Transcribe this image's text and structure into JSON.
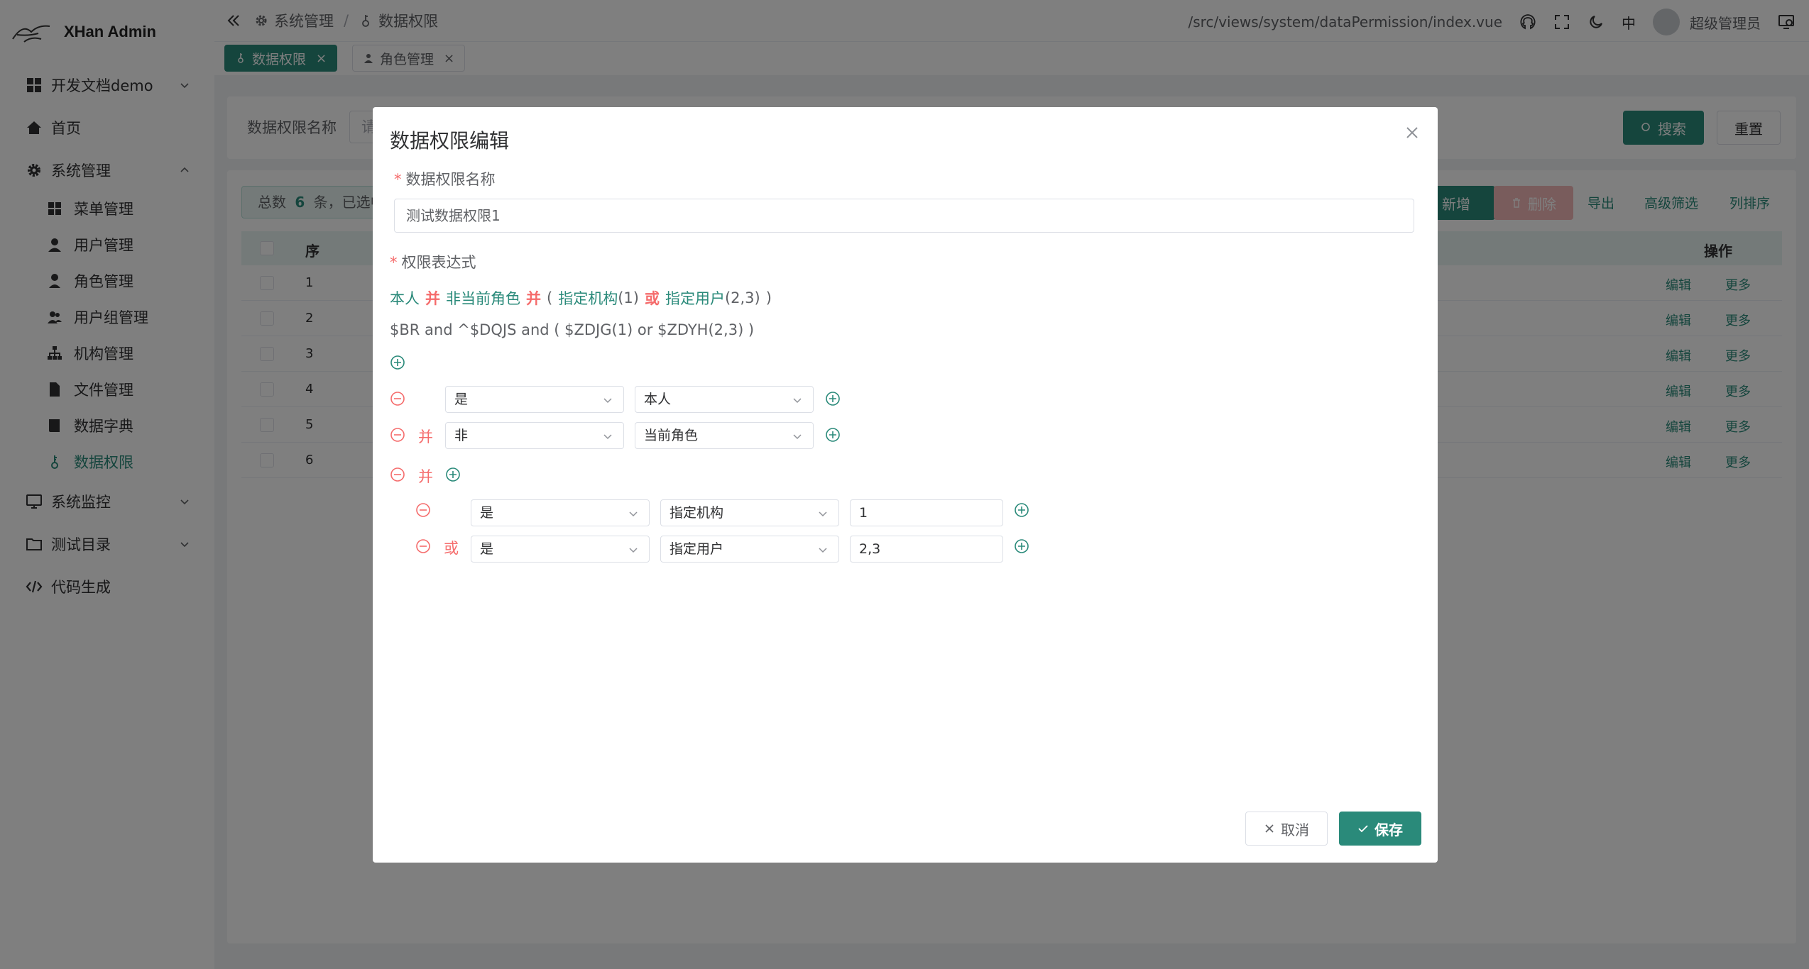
{
  "app": {
    "title": "XHan Admin"
  },
  "sidebar": {
    "items": [
      {
        "label": "开发文档demo",
        "icon": "grid-icon",
        "arrow": "down"
      },
      {
        "label": "首页",
        "icon": "home-icon"
      },
      {
        "label": "系统管理",
        "icon": "gear-icon",
        "arrow": "up"
      },
      {
        "label": "系统监控",
        "icon": "monitor-icon",
        "arrow": "down"
      },
      {
        "label": "测试目录",
        "icon": "folder-icon",
        "arrow": "down"
      },
      {
        "label": "代码生成",
        "icon": "code-icon"
      }
    ],
    "sub_items": [
      {
        "label": "菜单管理",
        "icon": "grid-icon"
      },
      {
        "label": "用户管理",
        "icon": "user-icon"
      },
      {
        "label": "角色管理",
        "icon": "user-tie-icon"
      },
      {
        "label": "用户组管理",
        "icon": "users-icon"
      },
      {
        "label": "机构管理",
        "icon": "sitemap-icon"
      },
      {
        "label": "文件管理",
        "icon": "file-icon"
      },
      {
        "label": "数据字典",
        "icon": "book-icon"
      },
      {
        "label": "数据权限",
        "icon": "key-icon"
      }
    ]
  },
  "header": {
    "breadcrumb": [
      "系统管理",
      "/",
      "数据权限"
    ],
    "path": "/src/views/system/dataPermission/index.vue",
    "lang": "中",
    "user": "超级管理员"
  },
  "tags": [
    {
      "label": "数据权限",
      "close": "×"
    },
    {
      "label": "角色管理",
      "close": "×"
    }
  ],
  "search": {
    "label": "数据权限名称",
    "placeholder": "请",
    "search_btn": "搜索",
    "reset_btn": "重置"
  },
  "table": {
    "total_prefix": "总数",
    "total_count": "6",
    "total_suffix": "条，已选中",
    "new_btn": "新增",
    "delete_btn": "删除",
    "export": "导出",
    "filter": "高级筛选",
    "sort": "列排序",
    "col_no": "序",
    "col_op": "操作",
    "rows": [
      "1",
      "2",
      "3",
      "4",
      "5",
      "6"
    ],
    "edit": "编辑",
    "more": "更多"
  },
  "dialog": {
    "title": "数据权限编辑",
    "name_label": "数据权限名称",
    "name_value": "测试数据权限1",
    "expr_label": "权限表达式",
    "expr_parts": [
      "本人",
      "并",
      "非",
      "当前角色",
      "并",
      "(",
      "指定机构",
      "(1)",
      "或",
      "指定用户",
      "(2,3)",
      ")"
    ],
    "expr_code": "$BR and ^$DQJS and ( $ZDJG(1) or $ZDYH(2,3) )",
    "rules": [
      {
        "op": "",
        "cond": "是",
        "field": "本人"
      },
      {
        "op": "并",
        "cond": "非",
        "field": "当前角色"
      }
    ],
    "group": {
      "op": "并",
      "rules": [
        {
          "op": "",
          "cond": "是",
          "field": "指定机构",
          "value": "1"
        },
        {
          "op": "或",
          "cond": "是",
          "field": "指定用户",
          "value": "2,3"
        }
      ]
    },
    "cancel_btn": "取消",
    "save_btn": "保存"
  },
  "colors": {
    "primary": "#2a8a7a",
    "danger": "#f56c6c"
  }
}
